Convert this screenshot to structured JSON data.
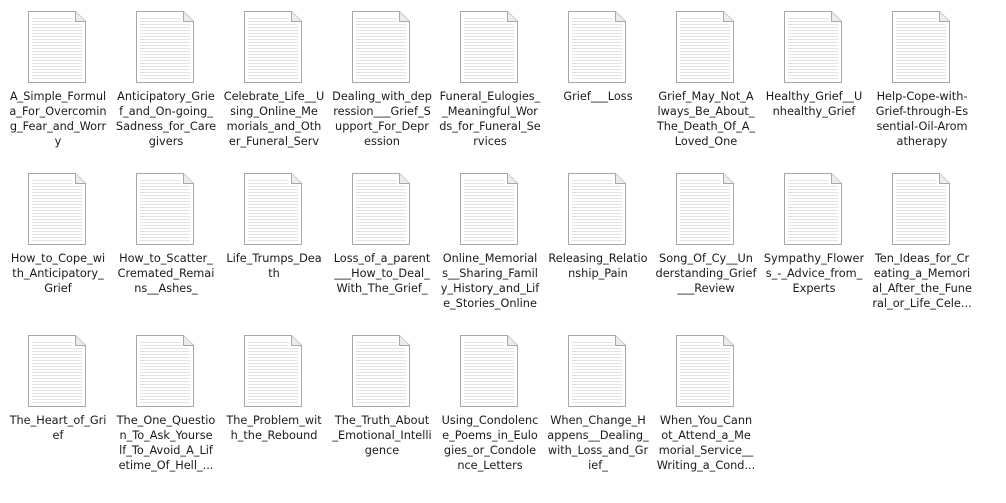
{
  "window": {
    "title": ""
  },
  "files": [
    {
      "name": "A_Simple_Formula_For_Overcoming_Fear_and_Worry",
      "label": "A_Simple_Formul\na_For_Overcomin\ng_Fear_and_Worr\ny",
      "icon": "text-document-icon"
    },
    {
      "name": "Anticipatory_Grief_and_On-going_Sadness_for_Caregivers",
      "label": "Anticipatory_Grie\nf_and_On-going_\nSadness_for_Care\ngivers",
      "icon": "text-document-icon"
    },
    {
      "name": "Celebrate_Life__Using_Online_Memorials_and_Other_Funeral_Servi...",
      "label": "Celebrate_Life__U\nsing_Online_Me\nmorials_and_Oth\ner_Funeral_Servi...",
      "icon": "text-document-icon"
    },
    {
      "name": "Dealing_with_depression___Grief_Support_For_Depression",
      "label": "Dealing_with_dep\nression___Grief_S\nupport_For_Depr\nession",
      "icon": "text-document-icon"
    },
    {
      "name": "Funeral_Eulogies__Meaningful_Words_for_Funeral_Services",
      "label": "Funeral_Eulogies_\n_Meaningful_Wor\nds_for_Funeral_Se\nrvices",
      "icon": "text-document-icon"
    },
    {
      "name": "Grief___Loss",
      "label": "Grief___Loss",
      "icon": "text-document-icon"
    },
    {
      "name": "Grief_May_Not_Always_Be_About_The_Death_Of_A_Loved_One",
      "label": "Grief_May_Not_A\nlways_Be_About_\nThe_Death_Of_A_\nLoved_One",
      "icon": "text-document-icon"
    },
    {
      "name": "Healthy_Grief__Unhealthy_Grief",
      "label": "Healthy_Grief__U\nnhealthy_Grief",
      "icon": "text-document-icon"
    },
    {
      "name": "Help-Cope-with-Grief-through-Essential-Oil-Aromatherapy",
      "label": "Help-Cope-with-\nGrief-through-Es\nsential-Oil-Arom\natherapy",
      "icon": "text-document-icon"
    },
    {
      "name": "How_to_Cope_with_Anticipatory_Grief",
      "label": "How_to_Cope_wi\nth_Anticipatory_\nGrief",
      "icon": "text-document-icon"
    },
    {
      "name": "How_to_Scatter_Cremated_Remains__Ashes_",
      "label": "How_to_Scatter_\nCremated_Remai\nns__Ashes_",
      "icon": "text-document-icon"
    },
    {
      "name": "Life_Trumps_Death",
      "label": "Life_Trumps_Dea\nth",
      "icon": "text-document-icon"
    },
    {
      "name": "Loss_of_a_parent___How_to_Deal_With_The_Grief_",
      "label": "Loss_of_a_parent\n___How_to_Deal_\nWith_The_Grief_",
      "icon": "text-document-icon"
    },
    {
      "name": "Online_Memorials_Sharing_Family_History_and_Life_Stories_Online",
      "label": "Online_Memorial\ns__Sharing_Famil\ny_History_and_Lif\ne_Stories_Online",
      "icon": "text-document-icon"
    },
    {
      "name": "Releasing_Relationship_Pain",
      "label": "Releasing_Relatio\nnship_Pain",
      "icon": "text-document-icon"
    },
    {
      "name": "Song_Of_Cy__Understanding_Grief___Review",
      "label": "Song_Of_Cy__Un\nderstanding_Grief\n___Review",
      "icon": "text-document-icon"
    },
    {
      "name": "Sympathy_Flowers_-_Advice_from_Experts",
      "label": "Sympathy_Flower\ns_-_Advice_from_\nExperts",
      "icon": "text-document-icon"
    },
    {
      "name": "Ten_Ideas_for_Creating_a_Memorial_After_the_Funeral_or_Life_Cele...",
      "label": "Ten_Ideas_for_Cr\neating_a_Memori\nal_After_the_Fune\nral_or_Life_Cele...",
      "icon": "text-document-icon"
    },
    {
      "name": "The_Heart_of_Grief",
      "label": "The_Heart_of_Gri\nef",
      "icon": "text-document-icon"
    },
    {
      "name": "The_One_Question_To_Ask_Yourself_To_Avoid_A_Lifetime_Of_Hell_...",
      "label": "The_One_Questio\nn_To_Ask_Yourse\nlf_To_Avoid_A_Lif\netime_Of_Hell_...",
      "icon": "text-document-icon"
    },
    {
      "name": "The_Problem_with_the_Rebound",
      "label": "The_Problem_wit\nh_the_Rebound",
      "icon": "text-document-icon"
    },
    {
      "name": "The_Truth_About_Emotional_Intelligence",
      "label": "The_Truth_About\n_Emotional_Intelli\ngence",
      "icon": "text-document-icon"
    },
    {
      "name": "Using_Condolence_Poems_in_Eulogies_or_Condolence_Letters",
      "label": "Using_Condolenc\ne_Poems_in_Eulo\ngies_or_Condole\nnce_Letters",
      "icon": "text-document-icon"
    },
    {
      "name": "When_Change_Happens__Dealing_with_Loss_and_Grief_",
      "label": "When_Change_H\nappens__Dealing_\nwith_Loss_and_Gr\nief_",
      "icon": "text-document-icon"
    },
    {
      "name": "When_You_Cannot_Attend_a_Memorial_Service__Writing_a_Cond...",
      "label": "When_You_Cann\not_Attend_a_Me\nmorial_Service__\nWriting_a_Cond...",
      "icon": "text-document-icon"
    }
  ]
}
